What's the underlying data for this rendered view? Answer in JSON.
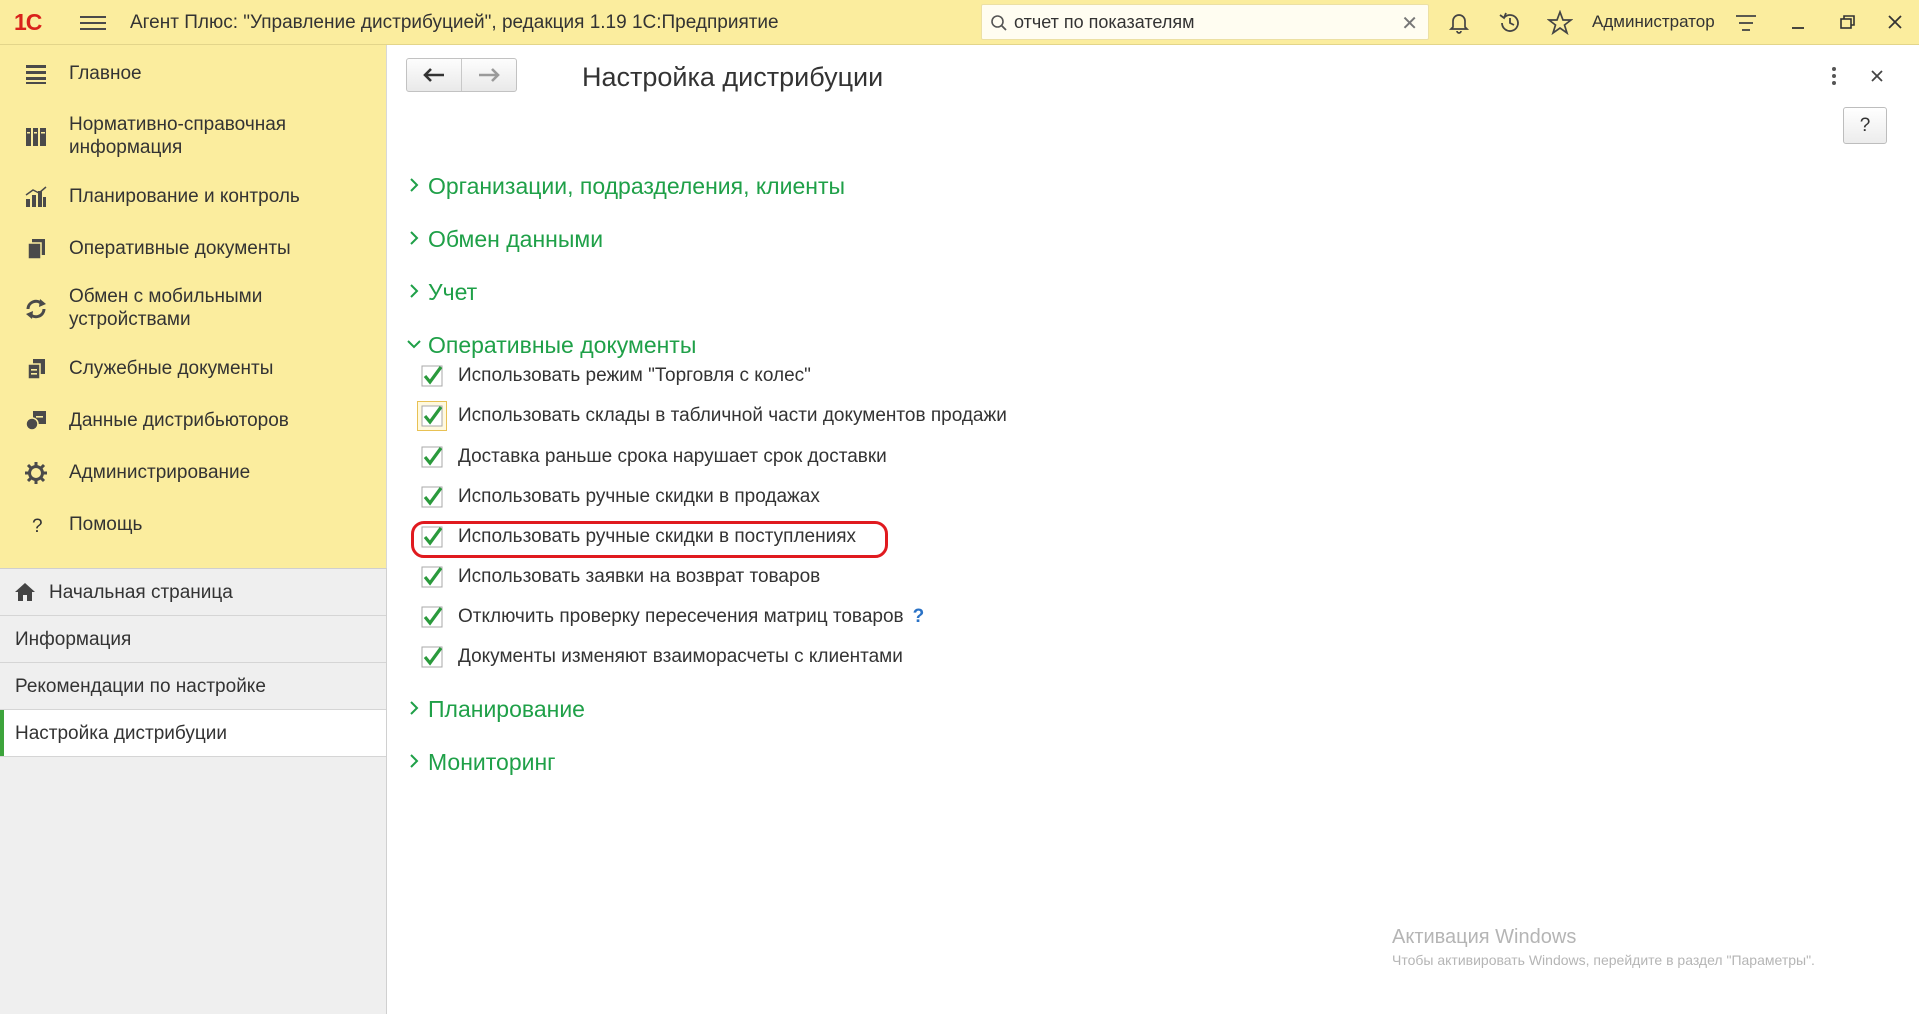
{
  "titlebar": {
    "logo_text": "1С",
    "app_title": "Агент Плюс: \"Управление дистрибуцией\", редакция 1.19 1С:Предприятие",
    "search_value": "отчет по показателям",
    "user_name": "Администратор"
  },
  "sections": [
    {
      "label": "Главное",
      "icon": "menu-lines-icon"
    },
    {
      "label": "Нормативно-справочная информация",
      "icon": "catalog-icon"
    },
    {
      "label": "Планирование и контроль",
      "icon": "bar-chart-icon"
    },
    {
      "label": "Оперативные документы",
      "icon": "documents-icon"
    },
    {
      "label": "Обмен с мобильными устройствами",
      "icon": "sync-icon"
    },
    {
      "label": "Служебные документы",
      "icon": "service-docs-icon"
    },
    {
      "label": "Данные дистрибьюторов",
      "icon": "distributor-data-icon"
    },
    {
      "label": "Администрирование",
      "icon": "gear-icon"
    },
    {
      "label": "Помощь",
      "icon": "question-icon"
    }
  ],
  "pages": [
    {
      "label": "Начальная страница",
      "icon": "home-icon",
      "active": false
    },
    {
      "label": "Информация",
      "active": false
    },
    {
      "label": "Рекомендации по настройке",
      "active": false
    },
    {
      "label": "Настройка дистрибуции",
      "active": true
    }
  ],
  "form": {
    "title": "Настройка дистрибуции",
    "help_label": "?",
    "groups": {
      "orgs": "Организации, подразделения, клиенты",
      "exchange": "Обмен данными",
      "accounting": "Учет",
      "operational": "Оперативные документы",
      "planning": "Планирование",
      "monitoring": "Мониторинг"
    },
    "options": [
      {
        "label": "Использовать режим \"Торговля с колес\"",
        "checked": true
      },
      {
        "label": "Использовать склады в табличной части документов продажи",
        "checked": true
      },
      {
        "label": "Доставка раньше срока нарушает срок доставки",
        "checked": true
      },
      {
        "label": "Использовать ручные скидки в продажах",
        "checked": true
      },
      {
        "label": "Использовать ручные скидки в поступлениях",
        "checked": true
      },
      {
        "label": "Использовать заявки на возврат товаров",
        "checked": true
      },
      {
        "label": "Отключить проверку пересечения матриц товаров",
        "checked": true,
        "hint": "?"
      },
      {
        "label": "Документы изменяют взаиморасчеты с клиентами",
        "checked": true
      }
    ]
  },
  "watermark": {
    "line1": "Активация Windows",
    "line2": "Чтобы активировать Windows, перейдите в раздел \"Параметры\"."
  },
  "colors": {
    "header_bg": "#fbed9e",
    "accent_green": "#1fa048",
    "check_green": "#2a9a3c",
    "highlight_red": "#e01a1f"
  }
}
